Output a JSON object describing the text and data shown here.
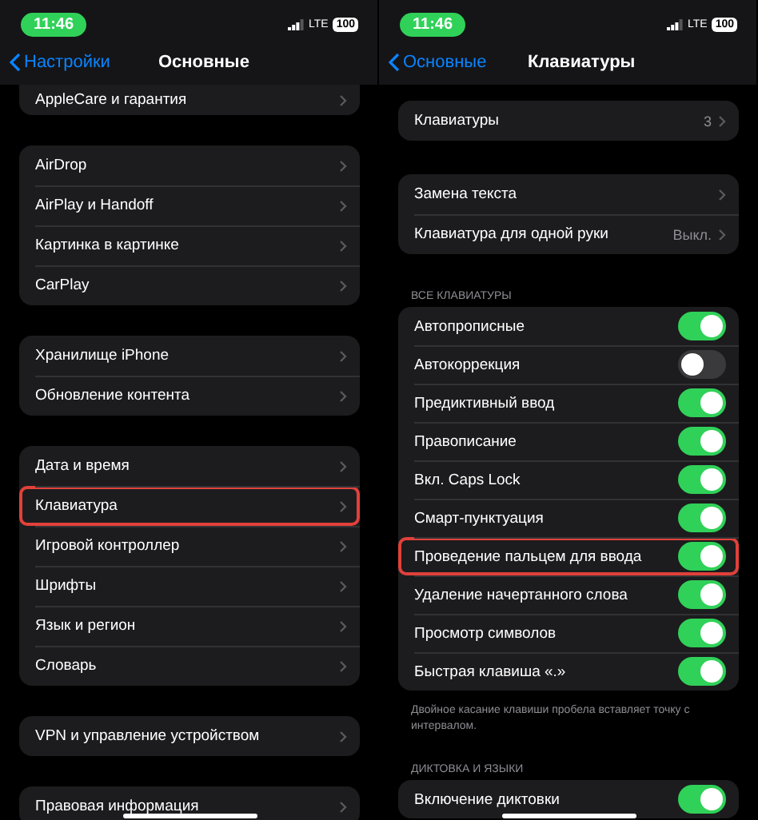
{
  "screens": [
    {
      "status": {
        "time": "11:46",
        "network": "LTE",
        "battery": "100"
      },
      "nav": {
        "back": "Настройки",
        "title": "Основные"
      },
      "scrolled": true,
      "sections": [
        {
          "rows": [
            {
              "kind": "link",
              "label": "AppleCare и гарантия",
              "highlighted": false
            }
          ]
        },
        {
          "rows": [
            {
              "kind": "link",
              "label": "AirDrop",
              "highlighted": false
            },
            {
              "kind": "link",
              "label": "AirPlay и Handoff",
              "highlighted": false
            },
            {
              "kind": "link",
              "label": "Картинка в картинке",
              "highlighted": false
            },
            {
              "kind": "link",
              "label": "CarPlay",
              "highlighted": false
            }
          ]
        },
        {
          "rows": [
            {
              "kind": "link",
              "label": "Хранилище iPhone",
              "highlighted": false
            },
            {
              "kind": "link",
              "label": "Обновление контента",
              "highlighted": false
            }
          ]
        },
        {
          "rows": [
            {
              "kind": "link",
              "label": "Дата и время",
              "highlighted": false
            },
            {
              "kind": "link",
              "label": "Клавиатура",
              "highlighted": true
            },
            {
              "kind": "link",
              "label": "Игровой контроллер",
              "highlighted": false
            },
            {
              "kind": "link",
              "label": "Шрифты",
              "highlighted": false
            },
            {
              "kind": "link",
              "label": "Язык и регион",
              "highlighted": false
            },
            {
              "kind": "link",
              "label": "Словарь",
              "highlighted": false
            }
          ]
        },
        {
          "rows": [
            {
              "kind": "link",
              "label": "VPN и управление устройством",
              "highlighted": false
            }
          ]
        },
        {
          "rows": [
            {
              "kind": "link",
              "label": "Правовая информация",
              "highlighted": false
            }
          ]
        }
      ]
    },
    {
      "status": {
        "time": "11:46",
        "network": "LTE",
        "battery": "100"
      },
      "nav": {
        "back": "Основные",
        "title": "Клавиатуры"
      },
      "scrolled": false,
      "sections": [
        {
          "rows": [
            {
              "kind": "link",
              "label": "Клавиатуры",
              "value": "3",
              "highlighted": false
            }
          ]
        },
        {
          "rows": [
            {
              "kind": "link",
              "label": "Замена текста",
              "highlighted": false
            },
            {
              "kind": "link",
              "label": "Клавиатура для одной руки",
              "value": "Выкл.",
              "highlighted": false
            }
          ]
        },
        {
          "header": "ВСЕ КЛАВИАТУРЫ",
          "footer": "Двойное касание клавиши пробела вставляет точку с интервалом.",
          "rows": [
            {
              "kind": "toggle",
              "label": "Автопрописные",
              "on": true,
              "highlighted": false
            },
            {
              "kind": "toggle",
              "label": "Автокоррекция",
              "on": false,
              "highlighted": false
            },
            {
              "kind": "toggle",
              "label": "Предиктивный ввод",
              "on": true,
              "highlighted": false
            },
            {
              "kind": "toggle",
              "label": "Правописание",
              "on": true,
              "highlighted": false
            },
            {
              "kind": "toggle",
              "label": "Вкл. Caps Lock",
              "on": true,
              "highlighted": false
            },
            {
              "kind": "toggle",
              "label": "Смарт-пунктуация",
              "on": true,
              "highlighted": false
            },
            {
              "kind": "toggle",
              "label": "Проведение пальцем для ввода",
              "on": true,
              "highlighted": true
            },
            {
              "kind": "toggle",
              "label": "Удаление начертанного слова",
              "on": true,
              "highlighted": false
            },
            {
              "kind": "toggle",
              "label": "Просмотр символов",
              "on": true,
              "highlighted": false
            },
            {
              "kind": "toggle",
              "label": "Быстрая клавиша «.»",
              "on": true,
              "highlighted": false
            }
          ]
        },
        {
          "header": "ДИКТОВКА И ЯЗЫКИ",
          "rows": [
            {
              "kind": "toggle",
              "label": "Включение диктовки",
              "on": true,
              "highlighted": false
            }
          ]
        }
      ]
    }
  ]
}
